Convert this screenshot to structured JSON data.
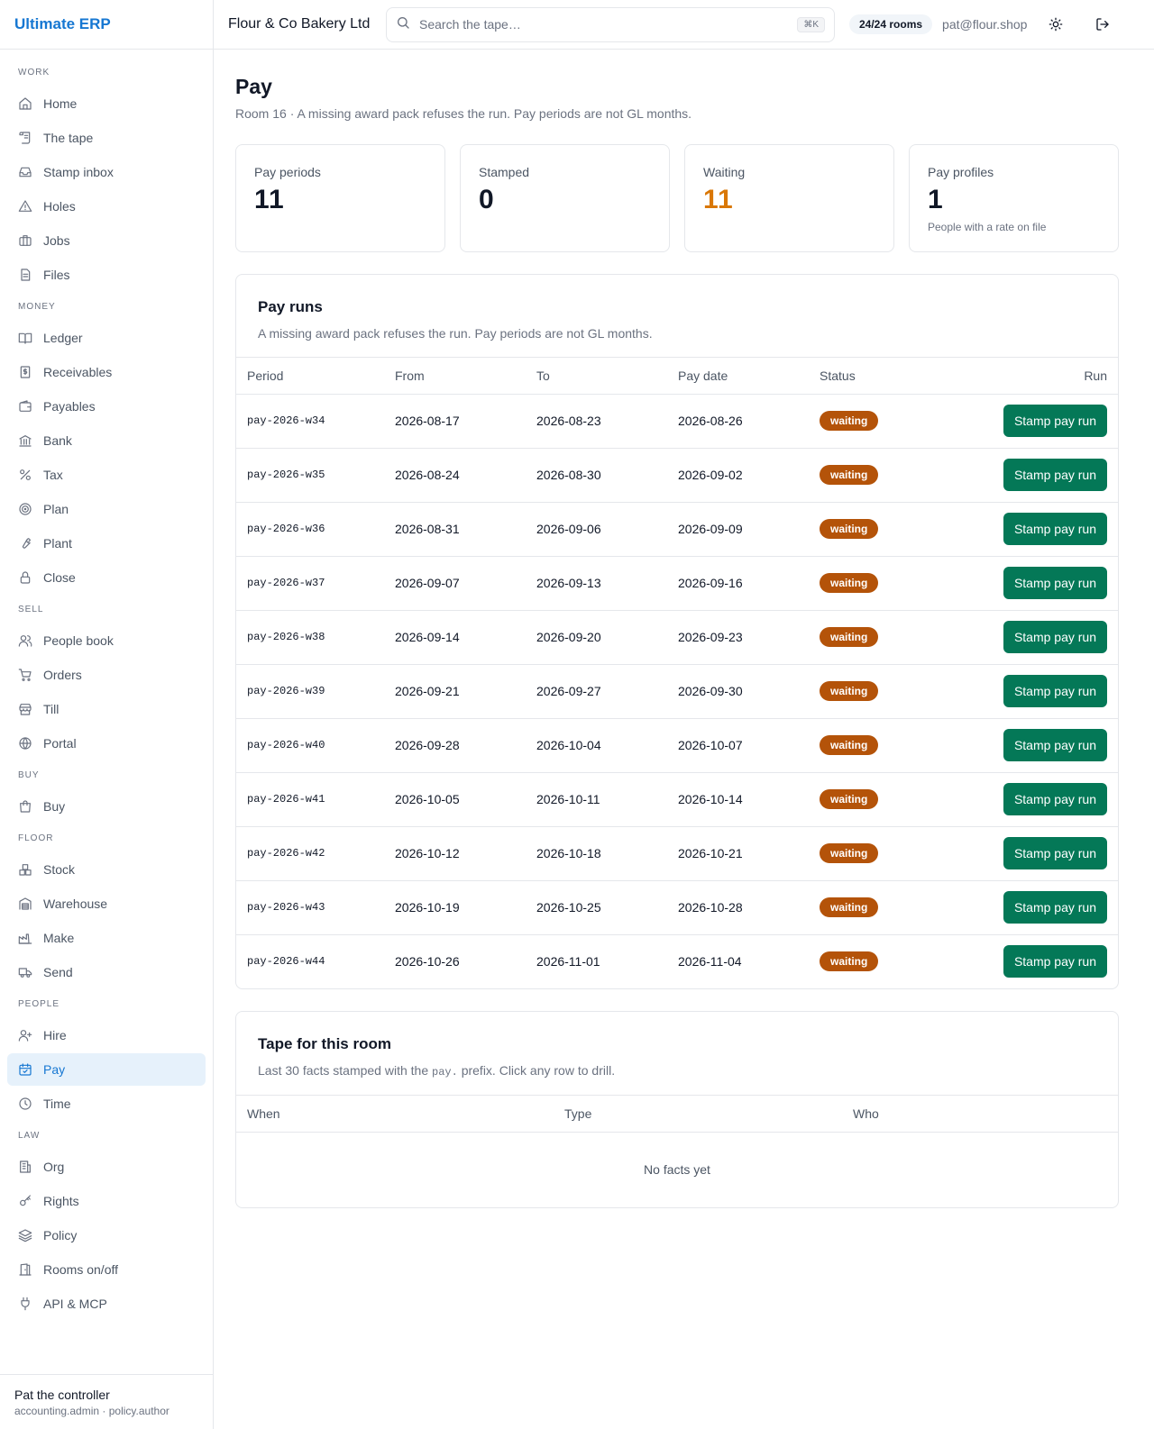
{
  "brand": "Ultimate ERP",
  "sidebar": {
    "sections": [
      {
        "label": "WORK",
        "items": [
          {
            "label": "Home",
            "icon": "home-icon"
          },
          {
            "label": "The tape",
            "icon": "scroll-icon"
          },
          {
            "label": "Stamp inbox",
            "icon": "inbox-icon"
          },
          {
            "label": "Holes",
            "icon": "warning-icon"
          },
          {
            "label": "Jobs",
            "icon": "briefcase-icon"
          },
          {
            "label": "Files",
            "icon": "file-icon"
          }
        ]
      },
      {
        "label": "MONEY",
        "items": [
          {
            "label": "Ledger",
            "icon": "book-icon"
          },
          {
            "label": "Receivables",
            "icon": "receipt-icon"
          },
          {
            "label": "Payables",
            "icon": "wallet-icon"
          },
          {
            "label": "Bank",
            "icon": "bank-icon"
          },
          {
            "label": "Tax",
            "icon": "percent-icon"
          },
          {
            "label": "Plan",
            "icon": "target-icon"
          },
          {
            "label": "Plant",
            "icon": "wrench-icon"
          },
          {
            "label": "Close",
            "icon": "lock-icon"
          }
        ]
      },
      {
        "label": "SELL",
        "items": [
          {
            "label": "People book",
            "icon": "users-icon"
          },
          {
            "label": "Orders",
            "icon": "cart-icon"
          },
          {
            "label": "Till",
            "icon": "store-icon"
          },
          {
            "label": "Portal",
            "icon": "globe-icon"
          }
        ]
      },
      {
        "label": "BUY",
        "items": [
          {
            "label": "Buy",
            "icon": "shopping-bag-icon"
          }
        ]
      },
      {
        "label": "FLOOR",
        "items": [
          {
            "label": "Stock",
            "icon": "boxes-icon"
          },
          {
            "label": "Warehouse",
            "icon": "warehouse-icon"
          },
          {
            "label": "Make",
            "icon": "factory-icon"
          },
          {
            "label": "Send",
            "icon": "truck-icon"
          }
        ]
      },
      {
        "label": "PEOPLE",
        "items": [
          {
            "label": "Hire",
            "icon": "user-plus-icon"
          },
          {
            "label": "Pay",
            "icon": "calendar-check-icon",
            "active": true
          },
          {
            "label": "Time",
            "icon": "clock-icon"
          }
        ]
      },
      {
        "label": "LAW",
        "items": [
          {
            "label": "Org",
            "icon": "building-icon"
          },
          {
            "label": "Rights",
            "icon": "key-icon"
          },
          {
            "label": "Policy",
            "icon": "layers-icon"
          },
          {
            "label": "Rooms on/off",
            "icon": "door-icon"
          },
          {
            "label": "API & MCP",
            "icon": "plug-icon"
          }
        ]
      }
    ],
    "user": {
      "name": "Pat the controller",
      "roles": "accounting.admin · policy.author"
    }
  },
  "topbar": {
    "company": "Flour & Co Bakery Ltd",
    "search_placeholder": "Search the tape…",
    "shortcut": "⌘K",
    "rooms": "24/24 rooms",
    "email": "pat@flour.shop"
  },
  "page": {
    "title": "Pay",
    "subtitle": "Room 16 · A missing award pack refuses the run. Pay periods are not GL months."
  },
  "stats": [
    {
      "label": "Pay periods",
      "value": "11",
      "note": ""
    },
    {
      "label": "Stamped",
      "value": "0",
      "note": ""
    },
    {
      "label": "Waiting",
      "value": "11",
      "note": "",
      "accent": "#d97706"
    },
    {
      "label": "Pay profiles",
      "value": "1",
      "note": "People with a rate on file"
    }
  ],
  "pay_runs": {
    "title": "Pay runs",
    "subtitle": "A missing award pack refuses the run. Pay periods are not GL months.",
    "columns": [
      "Period",
      "From",
      "To",
      "Pay date",
      "Status",
      "Run"
    ],
    "button_label": "Stamp pay run",
    "rows": [
      {
        "period": "pay-2026-w34",
        "from": "2026-08-17",
        "to": "2026-08-23",
        "pay_date": "2026-08-26",
        "status": "waiting"
      },
      {
        "period": "pay-2026-w35",
        "from": "2026-08-24",
        "to": "2026-08-30",
        "pay_date": "2026-09-02",
        "status": "waiting"
      },
      {
        "period": "pay-2026-w36",
        "from": "2026-08-31",
        "to": "2026-09-06",
        "pay_date": "2026-09-09",
        "status": "waiting"
      },
      {
        "period": "pay-2026-w37",
        "from": "2026-09-07",
        "to": "2026-09-13",
        "pay_date": "2026-09-16",
        "status": "waiting"
      },
      {
        "period": "pay-2026-w38",
        "from": "2026-09-14",
        "to": "2026-09-20",
        "pay_date": "2026-09-23",
        "status": "waiting"
      },
      {
        "period": "pay-2026-w39",
        "from": "2026-09-21",
        "to": "2026-09-27",
        "pay_date": "2026-09-30",
        "status": "waiting"
      },
      {
        "period": "pay-2026-w40",
        "from": "2026-09-28",
        "to": "2026-10-04",
        "pay_date": "2026-10-07",
        "status": "waiting"
      },
      {
        "period": "pay-2026-w41",
        "from": "2026-10-05",
        "to": "2026-10-11",
        "pay_date": "2026-10-14",
        "status": "waiting"
      },
      {
        "period": "pay-2026-w42",
        "from": "2026-10-12",
        "to": "2026-10-18",
        "pay_date": "2026-10-21",
        "status": "waiting"
      },
      {
        "period": "pay-2026-w43",
        "from": "2026-10-19",
        "to": "2026-10-25",
        "pay_date": "2026-10-28",
        "status": "waiting"
      },
      {
        "period": "pay-2026-w44",
        "from": "2026-10-26",
        "to": "2026-11-01",
        "pay_date": "2026-11-04",
        "status": "waiting"
      }
    ]
  },
  "tape": {
    "title": "Tape for this room",
    "subtitle_before": "Last 30 facts stamped with the ",
    "subtitle_code": "pay.",
    "subtitle_after": " prefix. Click any row to drill.",
    "columns": [
      "When",
      "Type",
      "Who"
    ],
    "empty": "No facts yet"
  },
  "colors": {
    "brand": "#1677d2",
    "status_waiting": "#b45309",
    "action": "#047857",
    "active_nav_bg": "#e6f1fb"
  }
}
